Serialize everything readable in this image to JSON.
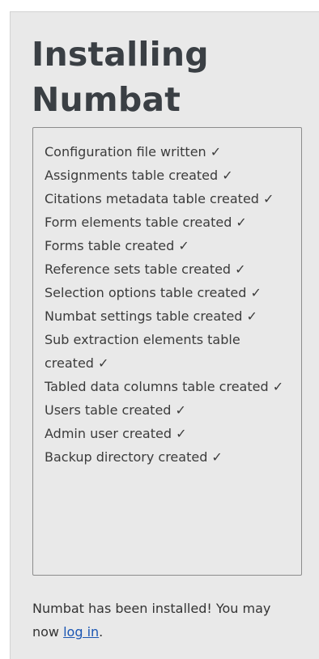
{
  "page": {
    "title": "Installing Numbat"
  },
  "log": {
    "items": [
      "Configuration file written ✓",
      "Assignments table created ✓",
      "Citations metadata table created ✓",
      "Form elements table created ✓",
      "Forms table created ✓",
      "Reference sets table created ✓",
      "Selection options table created ✓",
      "Numbat settings table created ✓",
      "Sub extraction elements table created ✓",
      "Tabled data columns table created ✓",
      "Users table created ✓",
      "Admin user created ✓",
      "Backup directory created ✓"
    ]
  },
  "footer": {
    "message_before": "Numbat has been installed! You may now ",
    "login_link": "log in",
    "message_after": "."
  }
}
